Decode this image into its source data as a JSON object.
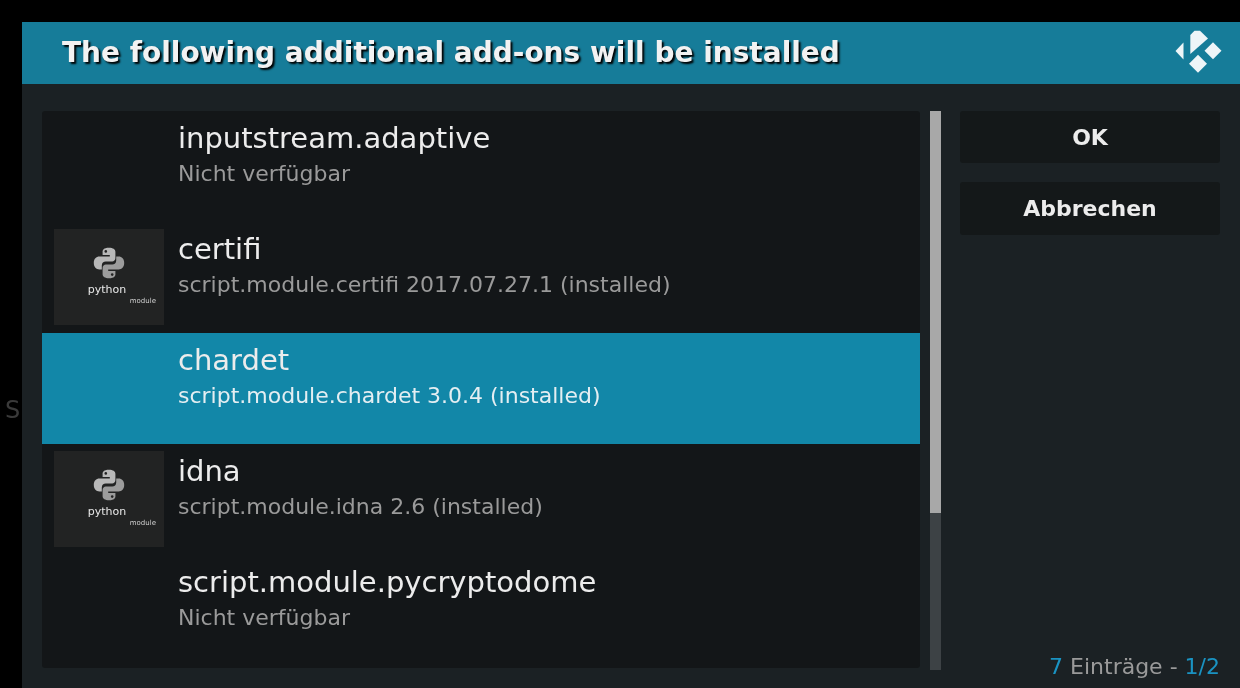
{
  "background": {
    "fragment": "S"
  },
  "dialog": {
    "title": "The following additional add-ons will be installed",
    "items": [
      {
        "name": "inputstream.adaptive",
        "detail": "Nicht verfügbar",
        "selected": false
      },
      {
        "name": "certifi",
        "detail": "script.module.certifi 2017.07.27.1 (installed)",
        "selected": false,
        "thumbnail": {
          "kind": "python",
          "wordmark": "python",
          "caption": "module"
        }
      },
      {
        "name": "chardet",
        "detail": "script.module.chardet 3.0.4 (installed)",
        "selected": true
      },
      {
        "name": "idna",
        "detail": "script.module.idna 2.6 (installed)",
        "selected": false,
        "thumbnail": {
          "kind": "python",
          "wordmark": "python",
          "caption": "module"
        }
      },
      {
        "name": "script.module.pycryptodome",
        "detail": "Nicht verfügbar",
        "selected": false
      }
    ],
    "buttons": [
      "OK",
      "Abbrechen"
    ],
    "footer": {
      "count": "7",
      "label": "Einträge -",
      "page": "1/2"
    }
  }
}
